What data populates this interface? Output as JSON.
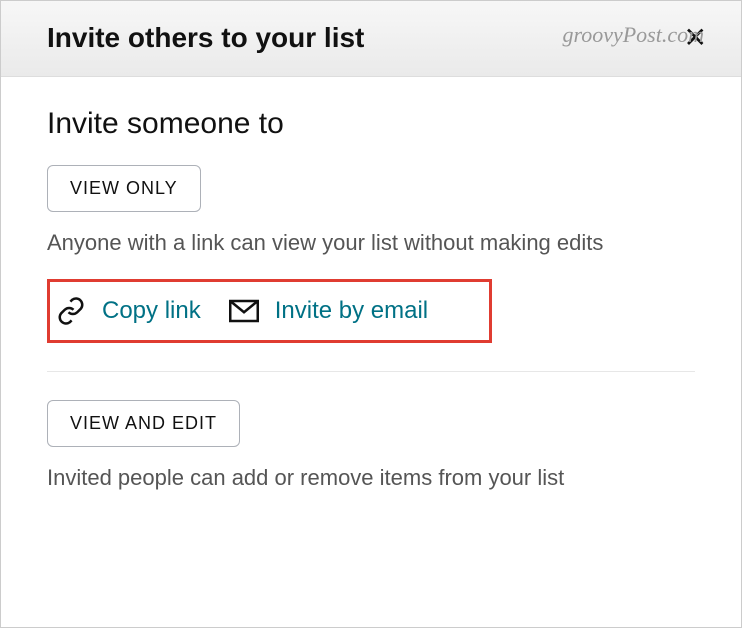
{
  "watermark": "groovyPost.com",
  "header": {
    "title": "Invite others to your list"
  },
  "main": {
    "section_title": "Invite someone to",
    "view_only": {
      "button": "VIEW ONLY",
      "desc": "Anyone with a link can view your list without making edits",
      "actions": {
        "copy_link": "Copy link",
        "invite_email": "Invite by email"
      }
    },
    "view_edit": {
      "button": "VIEW AND EDIT",
      "desc": "Invited people can add or remove items from your list"
    }
  }
}
